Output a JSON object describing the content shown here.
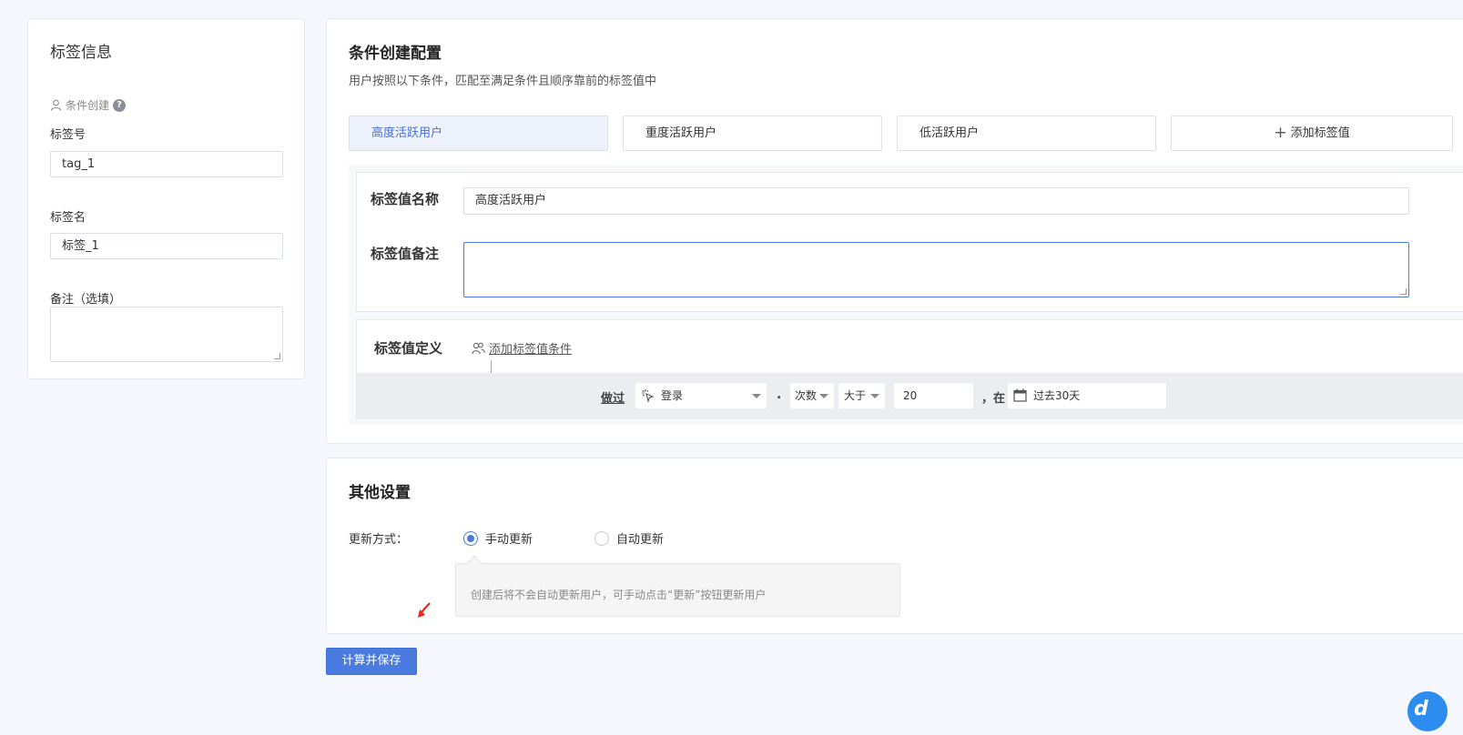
{
  "tag_info": {
    "title": "标签信息",
    "creation_type": "条件创建",
    "help": "?",
    "tag_id_label": "标签号",
    "tag_id_value": "tag_1",
    "tag_name_label": "标签名",
    "tag_name_value": "标签_1",
    "remark_label": "备注（选填）"
  },
  "condition_config": {
    "title": "条件创建配置",
    "description": "用户按照以下条件，匹配至满足条件且顺序靠前的标签值中",
    "tabs": [
      {
        "label": "高度活跃用户",
        "active": true
      },
      {
        "label": "重度活跃用户",
        "active": false
      },
      {
        "label": "低活跃用户",
        "active": false
      }
    ],
    "add_tab_label": "添加标签值",
    "value_name_label": "标签值名称",
    "value_name": "高度活跃用户",
    "value_remark_label": "标签值备注",
    "definition_label": "标签值定义",
    "add_condition_label": "添加标签值条件",
    "condition": {
      "verb": "做过",
      "event": "登录",
      "dot": ".",
      "metric": "次数",
      "operator": "大于",
      "value": "20",
      "in_label": "，在",
      "time_range": "过去30天"
    }
  },
  "other_settings": {
    "title": "其他设置",
    "update_label": "更新方式：",
    "options": [
      {
        "label": "手动更新",
        "checked": true
      },
      {
        "label": "自动更新",
        "checked": false
      }
    ],
    "tip": "创建后将不会自动更新用户，可手动点击“更新”按钮更新用户"
  },
  "actions": {
    "save_label": "计算并保存"
  },
  "colors": {
    "accent": "#4a7be0",
    "annotation_arrow": "#e8281e"
  },
  "chat_widget_label": "d"
}
